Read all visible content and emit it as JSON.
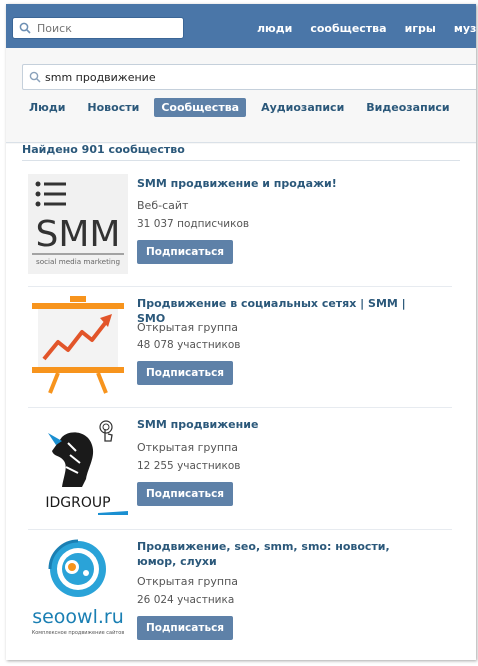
{
  "topbar": {
    "search_placeholder": "Поиск",
    "nav": [
      "люди",
      "сообщества",
      "игры",
      "музы"
    ]
  },
  "search": {
    "query": "smm продвижение"
  },
  "tabs": [
    {
      "label": "Люди",
      "active": false
    },
    {
      "label": "Новости",
      "active": false
    },
    {
      "label": "Сообщества",
      "active": true
    },
    {
      "label": "Аудиозаписи",
      "active": false
    },
    {
      "label": "Видеозаписи",
      "active": false
    }
  ],
  "results_header": "Найдено 901 сообщество",
  "results": [
    {
      "title": "SMM продвижение и продажи!",
      "type": "Веб-сайт",
      "members": "31 037 подписчиков",
      "button": "Подписаться",
      "logo_text": "SMM",
      "logo_subtext": "social media marketing"
    },
    {
      "title": "Продвижение в социальных сетях | SMM | SMO",
      "type": "Открытая группа",
      "members": "48 078 участников",
      "button": "Подписаться"
    },
    {
      "title": "SMM продвижение",
      "type": "Открытая группа",
      "members": "12 255 участников",
      "button": "Подписаться",
      "logo_text": "IDGROUP"
    },
    {
      "title": "Продвижение, seo, smm, smo: новости, юмор, слухи",
      "type": "Открытая группа",
      "members": "26 024 участника",
      "button": "Подписаться",
      "logo_text": "seoowl.ru",
      "logo_subtext": "Комплексное продвижение сайтов"
    }
  ],
  "colors": {
    "topbar": "#4a76a8",
    "link": "#2b587a",
    "button": "#5e81a8",
    "chart_orange": "#f7941d"
  }
}
